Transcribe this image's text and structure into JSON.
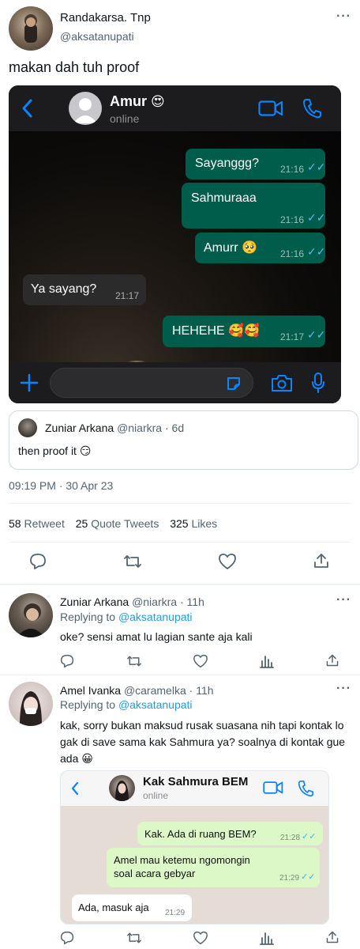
{
  "main_tweet": {
    "display_name": "Randakarsa. Tnp",
    "handle": "@aksatanupati",
    "text": "makan dah tuh proof",
    "timestamp": "09:19 PM · 30 Apr 23",
    "stats": {
      "retweets_count": "58",
      "retweets_label": "Retweet",
      "quotes_count": "25",
      "quotes_label": "Quote Tweets",
      "likes_count": "325",
      "likes_label": "Likes"
    }
  },
  "whatsapp_chat": {
    "contact_name": "Amur",
    "contact_emoji": "😍",
    "status": "online",
    "messages": [
      {
        "direction": "out",
        "text": "Sayanggg?",
        "time": "21:16"
      },
      {
        "direction": "out",
        "text": "Sahmuraaa",
        "time": "21:16"
      },
      {
        "direction": "out",
        "text": "Amurr 🥺",
        "time": "21:16"
      },
      {
        "direction": "in",
        "text": "Ya sayang?",
        "time": "21:17"
      },
      {
        "direction": "out",
        "text": "HEHEHE 🥰🥰",
        "time": "21:17"
      }
    ],
    "accent": "#0a84ff"
  },
  "quoted_tweet": {
    "display_name": "Zuniar Arkana",
    "handle": "@niarkra",
    "age": "6d",
    "text": "then proof it 😏"
  },
  "replies": [
    {
      "display_name": "Zuniar Arkana",
      "handle": "@niarkra",
      "age": "11h",
      "replying_label": "Replying to",
      "replying_to": "@aksatanupati",
      "text": "oke? sensi amat lu lagian sante aja kali"
    },
    {
      "display_name": "Amel Ivanka",
      "handle": "@caramelka",
      "age": "11h",
      "replying_label": "Replying to",
      "replying_to": "@aksatanupati",
      "text": "kak, sorry bukan maksud rusak suasana nih tapi kontak lo gak di save sama kak Sahmura ya? soalnya di kontak gue ada 😀"
    }
  ],
  "whatsapp_chat_2": {
    "contact_name": "Kak Sahmura BEM",
    "status": "online",
    "messages": [
      {
        "direction": "out",
        "text": "Kak. Ada di ruang BEM?",
        "time": "21:28"
      },
      {
        "direction": "out",
        "text": "Amel mau ketemu ngomongin soal acara gebyar",
        "time": "21:29"
      },
      {
        "direction": "in",
        "text": "Ada, masuk aja",
        "time": "21:29"
      }
    ]
  },
  "icons": [
    "back-icon",
    "video-call-icon",
    "phone-icon",
    "plus-icon",
    "sticker-icon",
    "camera-icon",
    "microphone-icon",
    "reply-icon",
    "retweet-icon",
    "like-icon",
    "share-icon",
    "analytics-icon",
    "more-icon"
  ],
  "colors": {
    "link": "#1d9bf0",
    "muted": "#536471",
    "wa_out": "#005c4b",
    "wa_in": "#2b2b2b",
    "wa2_out": "#dcf8c6"
  }
}
